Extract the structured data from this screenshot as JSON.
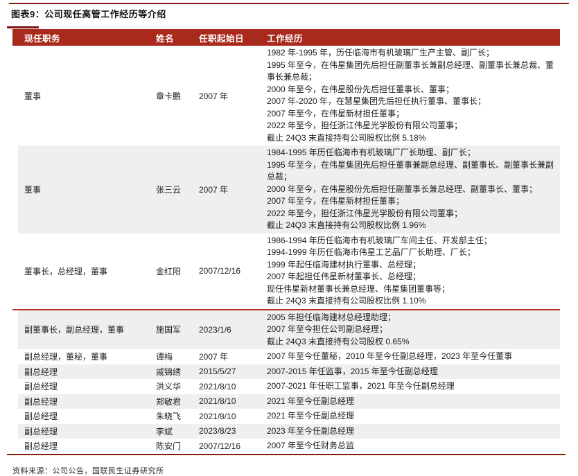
{
  "page": {
    "title": "图表9：公司现任高管工作经历等介绍",
    "source_note": "资料来源：公司公告，国联民生证券研究所"
  },
  "colors": {
    "header_bg": "#A92A1C",
    "accent_dark": "#7B150E",
    "top_rule": "#8C1A10",
    "row_stripe": "#EFEFEF",
    "section_divider": "#B03226",
    "bottom_rule": "#8C1A10"
  },
  "table": {
    "columns": [
      {
        "key": "position",
        "label": "现任职务"
      },
      {
        "key": "name",
        "label": "姓名"
      },
      {
        "key": "start_date",
        "label": "任职起始日"
      },
      {
        "key": "experience",
        "label": "工作经历"
      }
    ],
    "rows": [
      {
        "position": "董事",
        "name": "章卡鹏",
        "start_date": "2007 年",
        "experience": [
          "1982 年-1995 年，历任临海市有机玻璃厂生产主管、副厂长；",
          "1995 年至今，在伟星集团先后担任副董事长兼副总经理、副董事长兼总裁、董事长兼总裁；",
          "2000 年至今，在伟星股份先后担任董事长、董事；",
          "2007 年-2020 年，在慧星集团先后担任执行董事、董事长；",
          "2007 年至今，在伟星新材担任董事；",
          "2022 年至今，担任浙江伟星光学股份有限公司董事；",
          "截止 24Q3 末直接持有公司股权比例 5.18%"
        ]
      },
      {
        "position": "董事",
        "name": "张三云",
        "start_date": "2007 年",
        "experience": [
          "1984-1995 年历任临海市有机玻璃厂厂长助理、副厂长；",
          "1995 年至今，在伟星集团先后担任董事兼副总经理、副董事长、副董事长兼副总裁；",
          "2000 年至今，在伟星股份先后担任副董事长兼总经理、副董事长、董事；",
          "2007 年至今，在伟星新材担任董事；",
          "2022 年至今，担任浙江伟星光学股份有限公司董事；",
          "截止 24Q3 末直接持有公司股权比例 1.96%"
        ]
      },
      {
        "position": "董事长，总经理，董事",
        "name": "金红阳",
        "start_date": "2007/12/16",
        "divider_after": true,
        "experience": [
          "1986-1994 年历任临海市有机玻璃厂车间主任、开发部主任；",
          "1994-1999 年历任临海市伟星工艺品厂厂长助理、厂长；",
          "1999 年起任临海建材执行董事、总经理；",
          "2007 年起担任伟星新材董事长、总经理；",
          "现任伟星新材董事长兼总经理、伟星集团董事等；",
          "截止 24Q3 末直接持有公司股权比例 1.10%"
        ]
      },
      {
        "position": "副董事长，副总经理，董事",
        "name": "施国军",
        "start_date": "2023/1/6",
        "experience": [
          "2005 年担任临海建材总经理助理；",
          "2007 年至今担任公司副总经理；",
          "截止 24Q3 末直接持有公司股权 0.65%"
        ]
      },
      {
        "position": "副总经理，董秘，董事",
        "name": "谭梅",
        "start_date": "2007 年",
        "experience": [
          "2007 年至今任董秘，2010 年至今任副总经理，2023 年至今任董事"
        ]
      },
      {
        "position": "副总经理",
        "name": "戚锦绣",
        "start_date": "2015/5/27",
        "experience": [
          "2007-2015 年任监事，2015 年至今任副总经理"
        ]
      },
      {
        "position": "副总经理",
        "name": "洪义华",
        "start_date": "2021/8/10",
        "experience": [
          "2007-2021 年任职工监事，2021 年至今任副总经理"
        ]
      },
      {
        "position": "副总经理",
        "name": "郑敏君",
        "start_date": "2021/8/10",
        "experience": [
          "2021 年至今任副总经理"
        ]
      },
      {
        "position": "副总经理",
        "name": "朱晓飞",
        "start_date": "2021/8/10",
        "experience": [
          "2021 年至今任副总经理"
        ]
      },
      {
        "position": "副总经理",
        "name": "李斌",
        "start_date": "2023/8/23",
        "experience": [
          "2023 年至今任副总经理"
        ]
      },
      {
        "position": "副总经理",
        "name": "陈安门",
        "start_date": "2007/12/16",
        "experience": [
          "2007 年至今任财务总监"
        ]
      }
    ]
  }
}
